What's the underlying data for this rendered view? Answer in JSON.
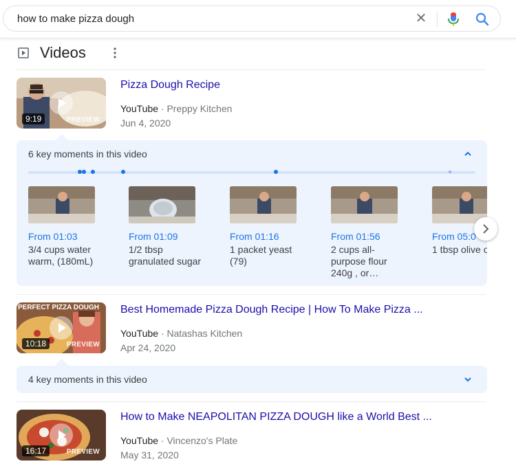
{
  "search": {
    "query": "how to make pizza dough",
    "clear_glyph": "✕"
  },
  "section": {
    "title": "Videos"
  },
  "videos": [
    {
      "title": "Pizza Dough Recipe",
      "source": "YouTube",
      "channel": "Preppy Kitchen",
      "date": "Jun 4, 2020",
      "duration": "9:19",
      "preview": "PREVIEW"
    },
    {
      "title": "Best Homemade Pizza Dough Recipe | How To Make Pizza ...",
      "source": "YouTube",
      "channel": "Natashas Kitchen",
      "date": "Apr 24, 2020",
      "duration": "10:18",
      "preview": "PREVIEW",
      "thumb_text": "PERFECT PIZZA DOUGH"
    },
    {
      "title": "How to Make NEAPOLITAN PIZZA DOUGH like a World Best ...",
      "source": "YouTube",
      "channel": "Vincenzo's Plate",
      "date": "May 31, 2020",
      "duration": "16:17",
      "preview": "PREVIEW"
    }
  ],
  "key_moments_1": {
    "title": "6 key moments in this video",
    "moments": [
      {
        "from": "From 01:03",
        "desc": "3/4 cups water warm, (180mL)"
      },
      {
        "from": "From 01:09",
        "desc": "1/2 tbsp granulated sugar"
      },
      {
        "from": "From 01:16",
        "desc": "1 packet yeast (79)"
      },
      {
        "from": "From 01:56",
        "desc": "2 cups all-purpose flour 240g , or…"
      },
      {
        "from": "From 05:0",
        "desc": "1 tbsp olive o"
      }
    ]
  },
  "key_moments_2": {
    "title": "4 key moments in this video"
  },
  "colors": {
    "link": "#1a0dab",
    "accent": "#1a73e8",
    "panel": "#eef4fd"
  }
}
